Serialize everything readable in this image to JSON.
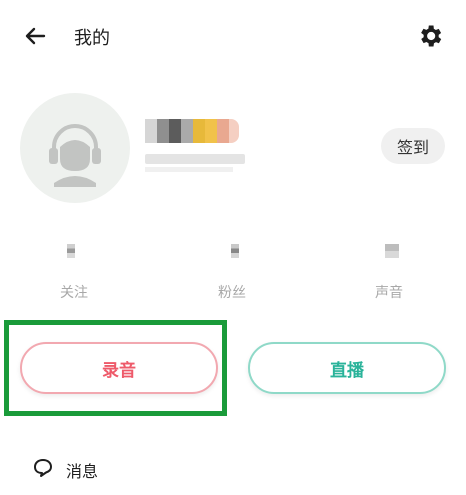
{
  "header": {
    "title": "我的",
    "back_icon": "arrow-left-icon",
    "settings_icon": "gear-icon"
  },
  "profile": {
    "avatar_icon": "headphones-avatar-icon",
    "checkin_label": "签到"
  },
  "stats": [
    {
      "label": "关注"
    },
    {
      "label": "粉丝"
    },
    {
      "label": "声音"
    }
  ],
  "actions": {
    "record_label": "录音",
    "live_label": "直播",
    "record_color": "#ee5a6a",
    "live_color": "#2ab39a",
    "highlight_color": "#1a9b3a"
  },
  "menu": {
    "messages_label": "消息",
    "messages_icon": "chat-bubble-icon"
  }
}
